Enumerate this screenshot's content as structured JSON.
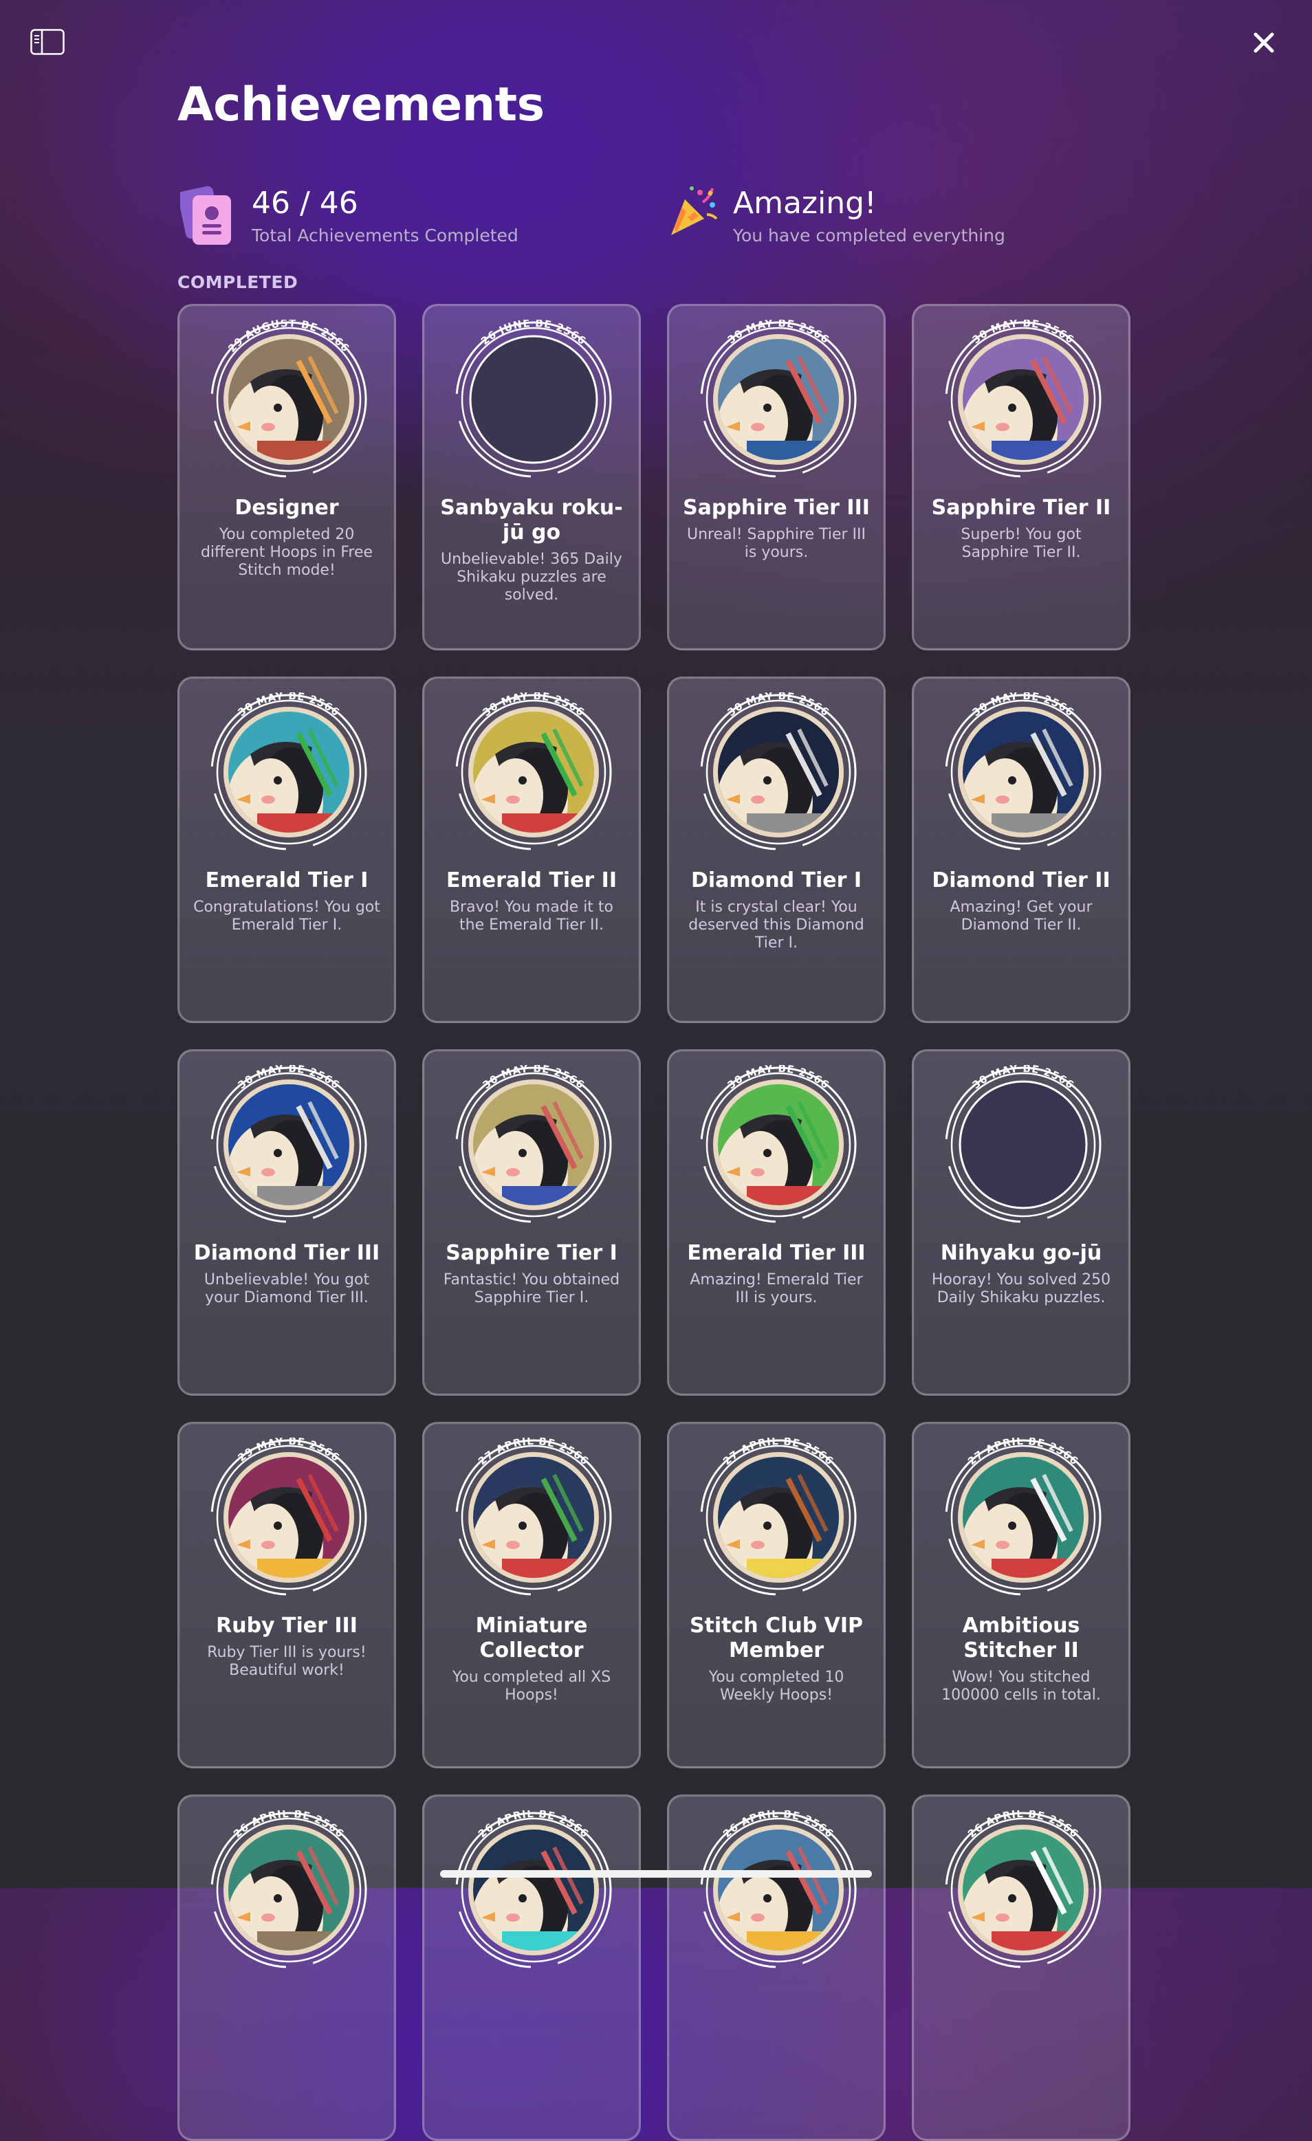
{
  "header": {
    "title": "Achievements",
    "sidebar_icon": "sidebar-toggle-icon",
    "close_icon": "close-icon"
  },
  "summary": {
    "count": "46 / 46",
    "count_caption": "Total Achievements Completed",
    "status": "Amazing!",
    "status_caption": "You have completed everything",
    "count_icon": "achievement-cards-icon",
    "status_icon": "party-popper-icon"
  },
  "section": {
    "completed_label": "COMPLETED"
  },
  "colors": {
    "accent_purple": "#4a1f9a",
    "card_border": "#b7b0c4",
    "badge_ring": "#ffffff"
  },
  "cards": [
    {
      "date": "29 AUGUST BE 2566",
      "name": "Designer",
      "desc": "You completed 20 different Hoops in Free Stitch mode!",
      "art": "designer"
    },
    {
      "date": "26 JUNE BE 2566",
      "name": "Sanbyaku roku-jū go",
      "desc": "Unbelievable! 365 Daily Shikaku puzzles are solved.",
      "art": "blank"
    },
    {
      "date": "30 MAY BE 2566",
      "name": "Sapphire Tier III",
      "desc": "Unreal! Sapphire Tier III is yours.",
      "art": "sapphire"
    },
    {
      "date": "30 MAY BE 2566",
      "name": "Sapphire Tier II",
      "desc": "Superb! You got Sapphire Tier II.",
      "art": "sapphire2"
    },
    {
      "date": "30 MAY BE 2566",
      "name": "Emerald Tier I",
      "desc": "Congratulations! You got Emerald Tier I.",
      "art": "emerald"
    },
    {
      "date": "30 MAY BE 2566",
      "name": "Emerald Tier II",
      "desc": "Bravo! You made it to the Emerald Tier II.",
      "art": "emerald2"
    },
    {
      "date": "30 MAY BE 2566",
      "name": "Diamond Tier I",
      "desc": "It is crystal clear! You deserved this Diamond Tier I.",
      "art": "diamond"
    },
    {
      "date": "30 MAY BE 2566",
      "name": "Diamond Tier II",
      "desc": "Amazing! Get your Diamond Tier II.",
      "art": "diamond2"
    },
    {
      "date": "30 MAY BE 2566",
      "name": "Diamond Tier III",
      "desc": "Unbelievable! You got your Diamond Tier III.",
      "art": "diamond3"
    },
    {
      "date": "30 MAY BE 2566",
      "name": "Sapphire Tier I",
      "desc": "Fantastic! You obtained Sapphire Tier I.",
      "art": "sapphire1"
    },
    {
      "date": "30 MAY BE 2566",
      "name": "Emerald Tier III",
      "desc": "Amazing! Emerald Tier III is yours.",
      "art": "emerald3"
    },
    {
      "date": "30 MAY BE 2566",
      "name": "Nihyaku go-jū",
      "desc": "Hooray! You solved 250 Daily Shikaku puzzles.",
      "art": "blank"
    },
    {
      "date": "29 MAY BE 2566",
      "name": "Ruby Tier III",
      "desc": "Ruby Tier III is yours! Beautiful work!",
      "art": "ruby"
    },
    {
      "date": "27 APRIL BE 2566",
      "name": "Miniature Collector",
      "desc": "You completed all XS Hoops!",
      "art": "mini"
    },
    {
      "date": "27 APRIL BE 2566",
      "name": "Stitch Club VIP Member",
      "desc": "You completed 10 Weekly Hoops!",
      "art": "vip"
    },
    {
      "date": "27 APRIL BE 2566",
      "name": "Ambitious Stitcher II",
      "desc": "Wow! You stitched 100000 cells in total.",
      "art": "ambitious"
    },
    {
      "date": "26 APRIL BE 2566",
      "name": "",
      "desc": "",
      "art": "p1"
    },
    {
      "date": "26 APRIL BE 2566",
      "name": "",
      "desc": "",
      "art": "p2"
    },
    {
      "date": "26 APRIL BE 2566",
      "name": "",
      "desc": "",
      "art": "p3"
    },
    {
      "date": "26 APRIL BE 2566",
      "name": "",
      "desc": "",
      "art": "p4"
    }
  ]
}
